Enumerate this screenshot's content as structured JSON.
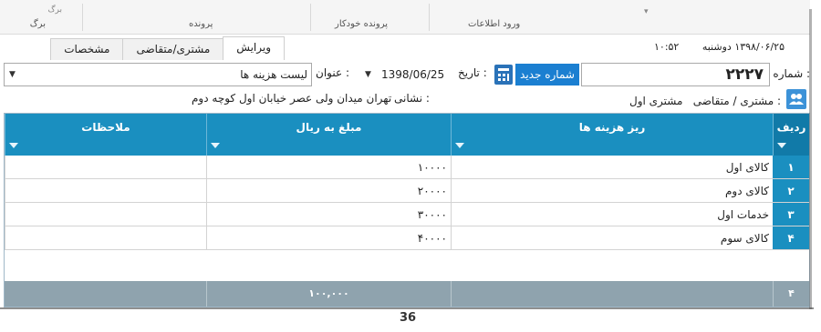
{
  "ribbon": {
    "groups": [
      {
        "label": "برگ",
        "sub": "برگ"
      },
      {
        "label": "پرونده"
      },
      {
        "label": "پرونده خودکار"
      },
      {
        "label": "ورود اطلاعات"
      }
    ]
  },
  "tabs": [
    "ویرایش",
    "مشتری/متقاضی",
    "مشخصات"
  ],
  "datetime": {
    "time": "۱۰:۵۲",
    "day": "دوشنبه",
    "date": "۱۳۹۸/۰۶/۲۵"
  },
  "form": {
    "number_label": "شماره :",
    "number_value": "۲۲۲۷",
    "new_number_button": "شماره جدید",
    "date_label": "تاریخ :",
    "date_value": "1398/06/25",
    "title_label": "عنوان :",
    "title_value": "لیست هزینه ها"
  },
  "customer": {
    "label": "مشتری / متقاضی :",
    "value": "مشتری اول",
    "address_label": "نشانی :",
    "address_value": "تهران میدان ولی عصر خیابان اول کوچه دوم"
  },
  "table": {
    "columns": [
      "ردیف",
      "ریز هزینه ها",
      "مبلغ به ریال",
      "ملاحظات"
    ],
    "rows": [
      {
        "n": "۱",
        "item": "کالای اول",
        "amount": "۱۰۰۰۰",
        "note": ""
      },
      {
        "n": "۲",
        "item": "کالای دوم",
        "amount": "۲۰۰۰۰",
        "note": ""
      },
      {
        "n": "۳",
        "item": "خدمات اول",
        "amount": "۳۰۰۰۰",
        "note": ""
      },
      {
        "n": "۴",
        "item": "کالای سوم",
        "amount": "۴۰۰۰۰",
        "note": ""
      }
    ],
    "footer": {
      "count": "۴",
      "total": "۱۰۰,۰۰۰"
    }
  },
  "page_number": "36",
  "colors": {
    "header": "#1a8fc0",
    "button": "#1b7fd1",
    "footer": "#8fa3ae"
  }
}
